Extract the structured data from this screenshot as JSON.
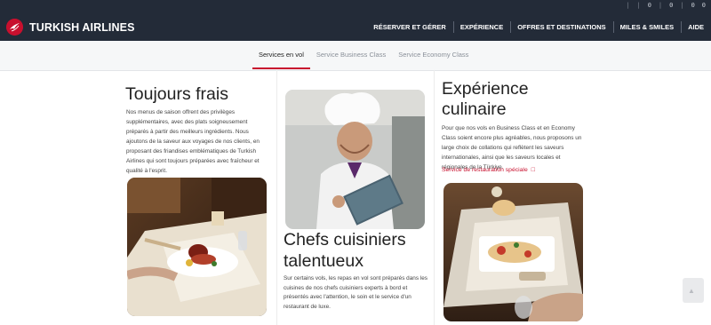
{
  "utility_bar": {
    "items": [
      "|",
      "|",
      "0",
      "|",
      "0",
      "|",
      "0",
      "0"
    ]
  },
  "header": {
    "logo_text": "TURKISH AIRLINES",
    "menu": [
      "RÉSERVER ET GÉRER",
      "EXPÉRIENCE",
      "OFFRES ET DESTINATIONS",
      "MILES & SMILES",
      "AIDE"
    ]
  },
  "tabs": [
    {
      "label": "Services en vol",
      "active": true
    },
    {
      "label": "Service Business Class",
      "active": false
    },
    {
      "label": "Service Economy Class",
      "active": false
    }
  ],
  "sections": {
    "fresh": {
      "title": "Toujours frais",
      "body": "Nos menus de saison offrent des privilèges supplémentaires, avec des plats soigneusement préparés à partir des meilleurs ingrédients. Nous ajoutons de la saveur aux voyages de nos clients, en proposant des friandises emblématiques de Turkish Airlines qui sont toujours préparées avec fraîcheur et qualité à l'esprit."
    },
    "chefs": {
      "title": "Chefs cuisiniers talentueux",
      "body": "Sur certains vols, les repas en vol sont préparés dans les cuisines de nos chefs cuisiniers experts à bord et présentés avec l'attention, le soin et le service d'un restaurant de luxe."
    },
    "culinary": {
      "title": "Expérience culinaire",
      "body": "Pour que nos vols en Business Class et en Economy Class soient encore plus agréables, nous proposons un large choix de collations qui reflètent les saveurs internationales, ainsi que les saveurs locales et régionales de la Türkiye.",
      "link_label": "Service de restauration spéciale"
    }
  },
  "colors": {
    "brand_red": "#c8102e",
    "nav_bg": "#232b38"
  },
  "icons": {
    "logo": "turkish-airlines-logo",
    "external_link": "external-link-icon",
    "back_to_top": "back-to-top-icon"
  }
}
